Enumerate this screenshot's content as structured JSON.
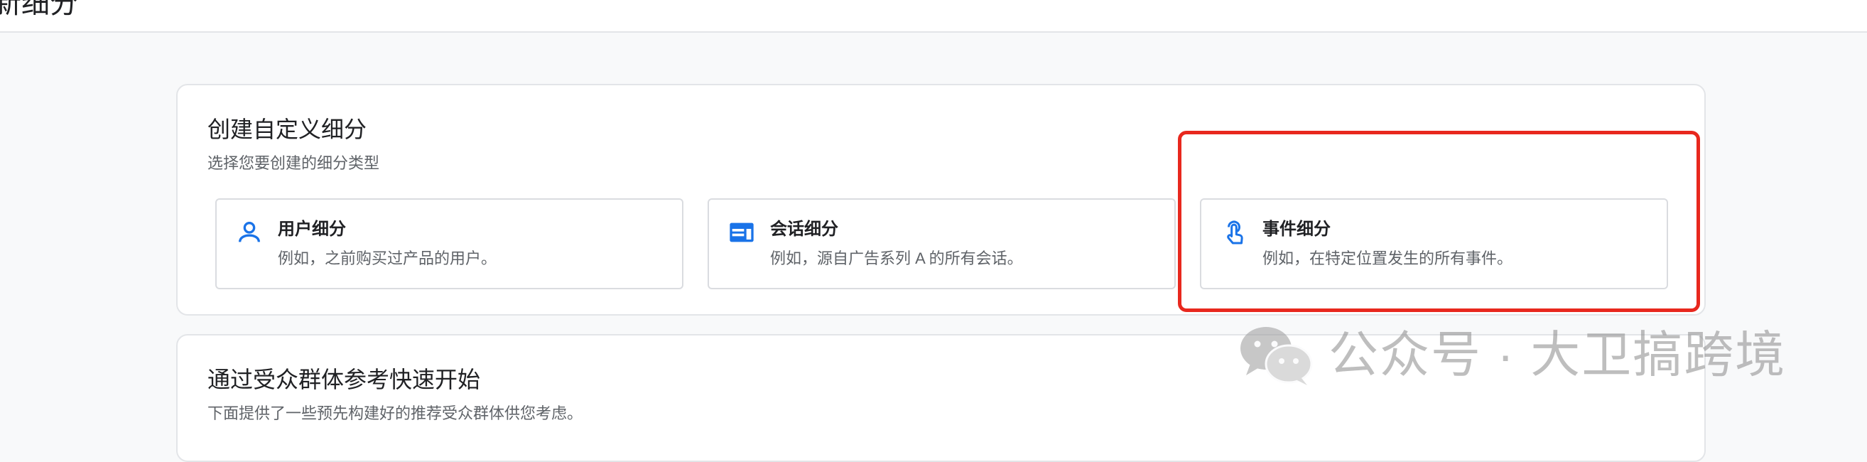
{
  "topbar": {
    "title": "新细分"
  },
  "create_section": {
    "title": "创建自定义细分",
    "subtitle": "选择您要创建的细分类型",
    "options": [
      {
        "title": "用户细分",
        "description": "例如，之前购买过产品的用户。",
        "icon": "person-icon"
      },
      {
        "title": "会话细分",
        "description": "例如，源自广告系列 A 的所有会话。",
        "icon": "session-icon"
      },
      {
        "title": "事件细分",
        "description": "例如，在特定位置发生的所有事件。",
        "icon": "touch-icon"
      }
    ]
  },
  "quick_section": {
    "title": "通过受众群体参考快速开始",
    "subtitle": "下面提供了一些预先构建好的推荐受众群体供您考虑。"
  },
  "annotation": {
    "highlight_color": "#e8281e"
  },
  "watermark": {
    "text": "公众号 · 大卫搞跨境",
    "icon": "wechat-icon"
  },
  "colors": {
    "accent": "#1a73e8",
    "background": "#f8f9fa"
  }
}
